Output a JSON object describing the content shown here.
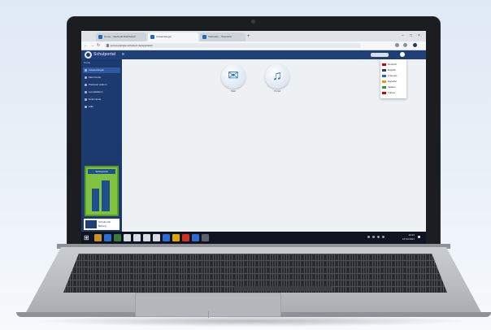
{
  "browser": {
    "tabs": [
      {
        "label": "Home – Webmail Dashboard"
      },
      {
        "label": "Anwendungen"
      },
      {
        "label": "Startseite – Übersicht"
      }
    ],
    "new_tab": "+",
    "url": "portal.example-schulnetz.de/apps/start",
    "controls": {
      "minimize": "–",
      "maximize": "□",
      "close": "×"
    },
    "nav": {
      "back": "←",
      "forward": "→",
      "reload": "↻"
    }
  },
  "app": {
    "title": "Schulportal",
    "menu_icon": "≡",
    "sidebar": {
      "home": "Home",
      "items": [
        {
          "label": "Anwendungen"
        },
        {
          "label": "Mein Konto"
        },
        {
          "label": "Passwort ändern"
        },
        {
          "label": "Lernplattform"
        },
        {
          "label": "Dokumente"
        },
        {
          "label": "Hilfe"
        }
      ],
      "promo_title": "Schulportal",
      "logo_text_1": "Schulportal",
      "logo_text_2": "Bildung"
    },
    "tiles": [
      {
        "label": "Mail",
        "icon": "mail-icon"
      },
      {
        "label": "Portal",
        "icon": "portal-icon"
      }
    ],
    "language_menu": {
      "items": [
        {
          "label": "Deutsch",
          "color": "#d00000"
        },
        {
          "label": "English",
          "color": "#1f3f78"
        },
        {
          "label": "Français",
          "color": "#2c5fd1"
        },
        {
          "label": "Español",
          "color": "#e0a000"
        },
        {
          "label": "Italiano",
          "color": "#1f9a3c"
        },
        {
          "label": "Türkçe",
          "color": "#d00000"
        }
      ]
    }
  },
  "taskbar": {
    "start": "⊞",
    "time": "10:24",
    "date": "12.03.2021",
    "icons": [
      "#c98f2a",
      "#2d6ad1",
      "#3b7a3a",
      "#d8dde3",
      "#d8dde3",
      "#d8dde3",
      "#d8dde3",
      "#2d6ad1",
      "#e0a300",
      "#d03020",
      "#2d6ad1",
      "#5a6270"
    ]
  },
  "colors": {
    "header": "#1f3f78",
    "sidebar": "#1d3a6e",
    "accent": "#2f5aa3",
    "promo": "#7ec23f"
  }
}
